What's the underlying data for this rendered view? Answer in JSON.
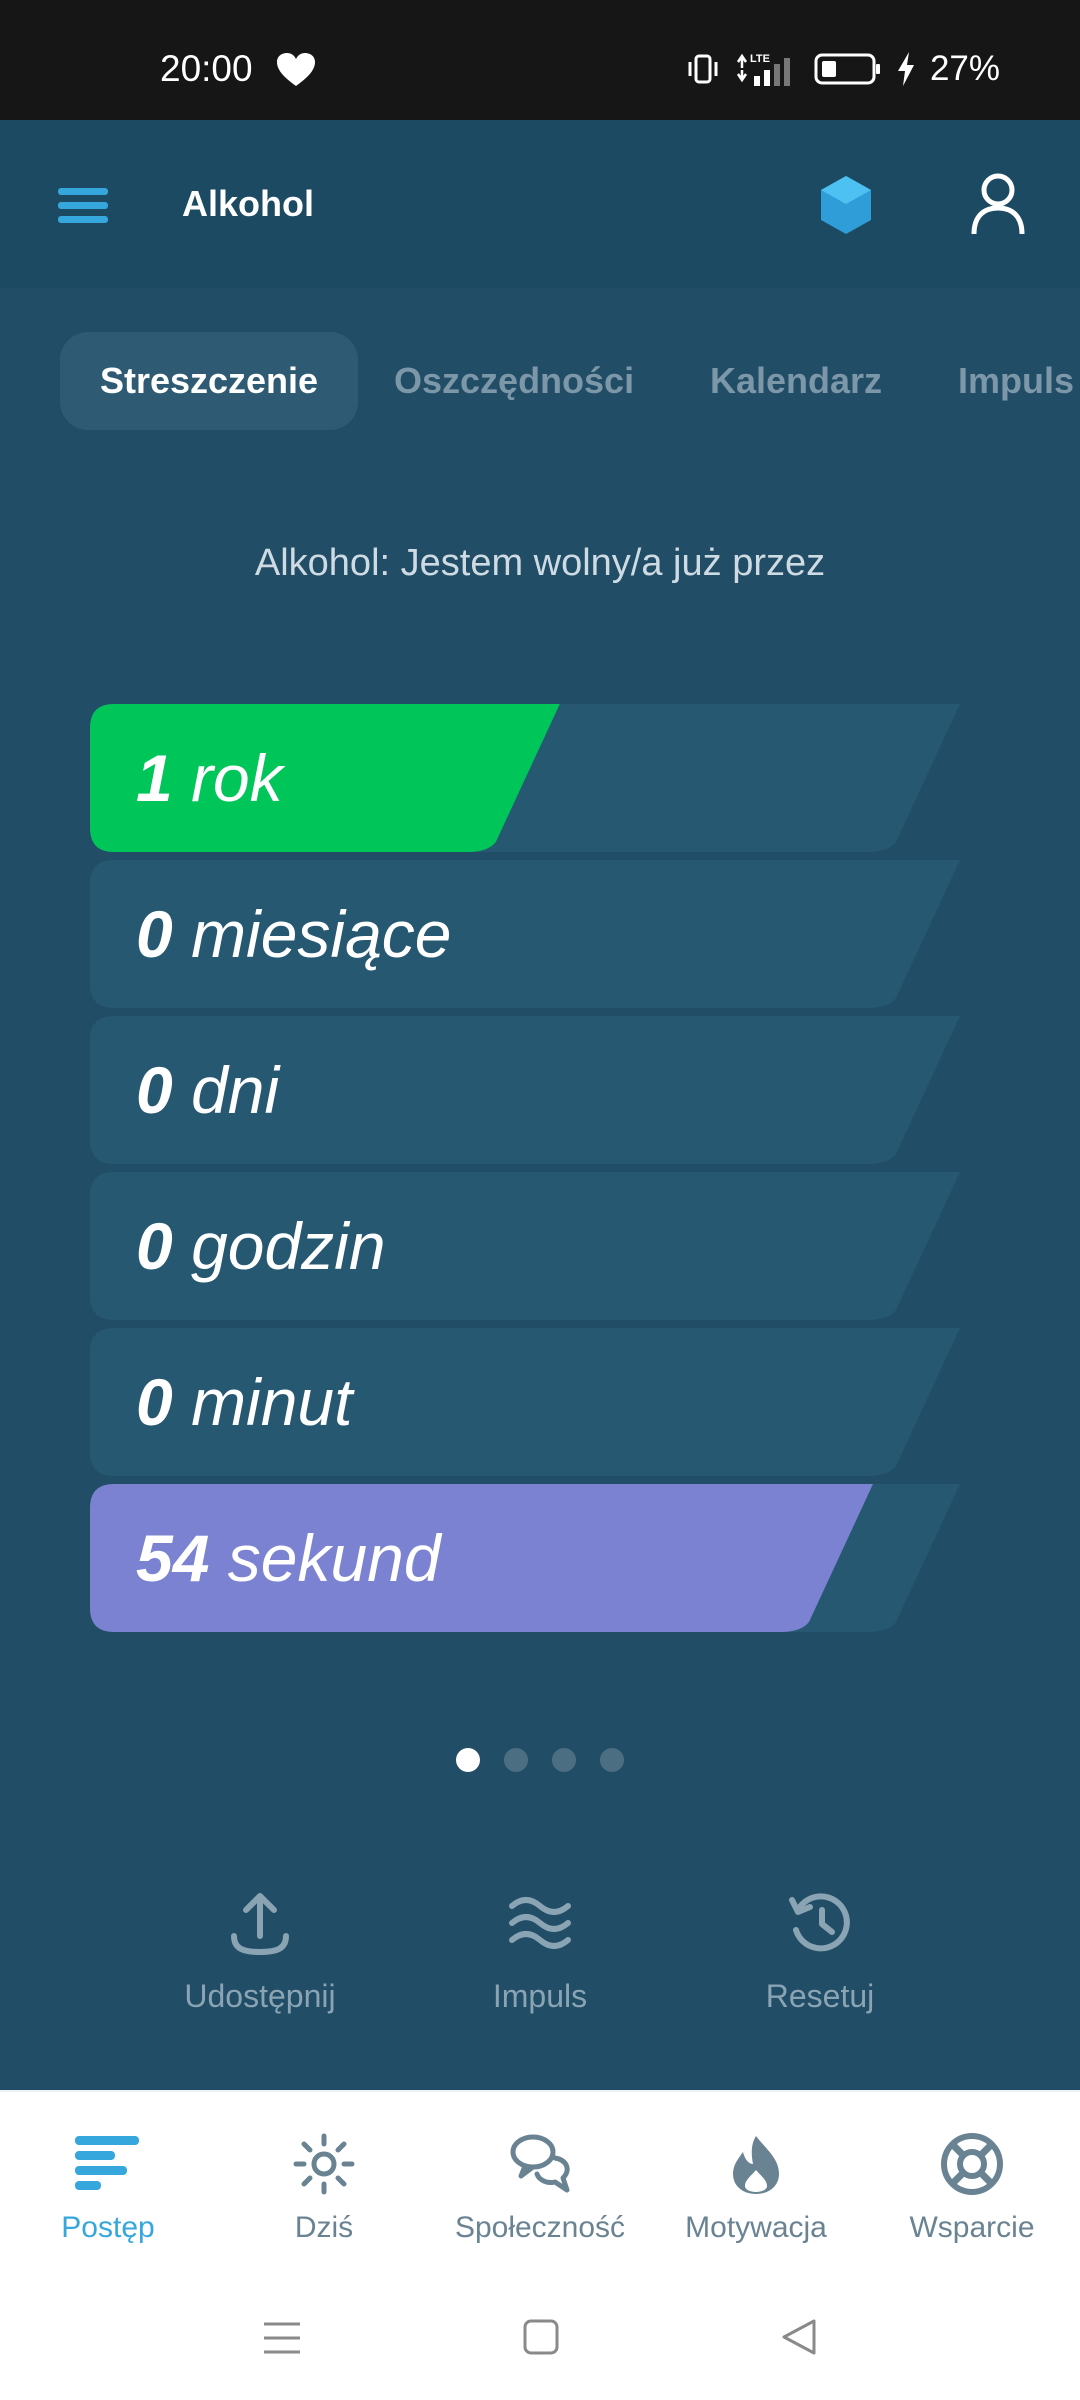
{
  "status_bar": {
    "time": "20:00",
    "battery": "27%"
  },
  "app_bar": {
    "title": "Alkohol"
  },
  "tabs": [
    {
      "label": "Streszczenie",
      "active": true
    },
    {
      "label": "Oszczędności"
    },
    {
      "label": "Kalendarz"
    },
    {
      "label": "Impuls"
    }
  ],
  "summary": {
    "subtitle": "Alkohol: Jestem wolny/a już przez",
    "rows": [
      {
        "value": "1",
        "unit": "rok",
        "fill": 0.54,
        "color": "#00c65a"
      },
      {
        "value": "0",
        "unit": "miesiące",
        "fill": 0
      },
      {
        "value": "0",
        "unit": "dni",
        "fill": 0
      },
      {
        "value": "0",
        "unit": "godzin",
        "fill": 0
      },
      {
        "value": "0",
        "unit": "minut",
        "fill": 0
      },
      {
        "value": "54",
        "unit": "sekund",
        "fill": 0.9,
        "color": "#7b82d1"
      }
    ]
  },
  "pager": {
    "count": 4,
    "active": 0
  },
  "actions": [
    {
      "label": "Udostępnij",
      "icon": "share-icon"
    },
    {
      "label": "Impuls",
      "icon": "waves-icon"
    },
    {
      "label": "Resetuj",
      "icon": "history-icon"
    }
  ],
  "bottom_nav": [
    {
      "label": "Postęp",
      "icon": "progress-icon",
      "active": true
    },
    {
      "label": "Dziś",
      "icon": "sun-icon"
    },
    {
      "label": "Społeczność",
      "icon": "community-icon"
    },
    {
      "label": "Motywacja",
      "icon": "flame-icon"
    },
    {
      "label": "Wsparcie",
      "icon": "lifebuoy-icon"
    }
  ],
  "colors": {
    "background": "#214d66",
    "accent": "#36a7dd",
    "row_track": "#265872"
  }
}
